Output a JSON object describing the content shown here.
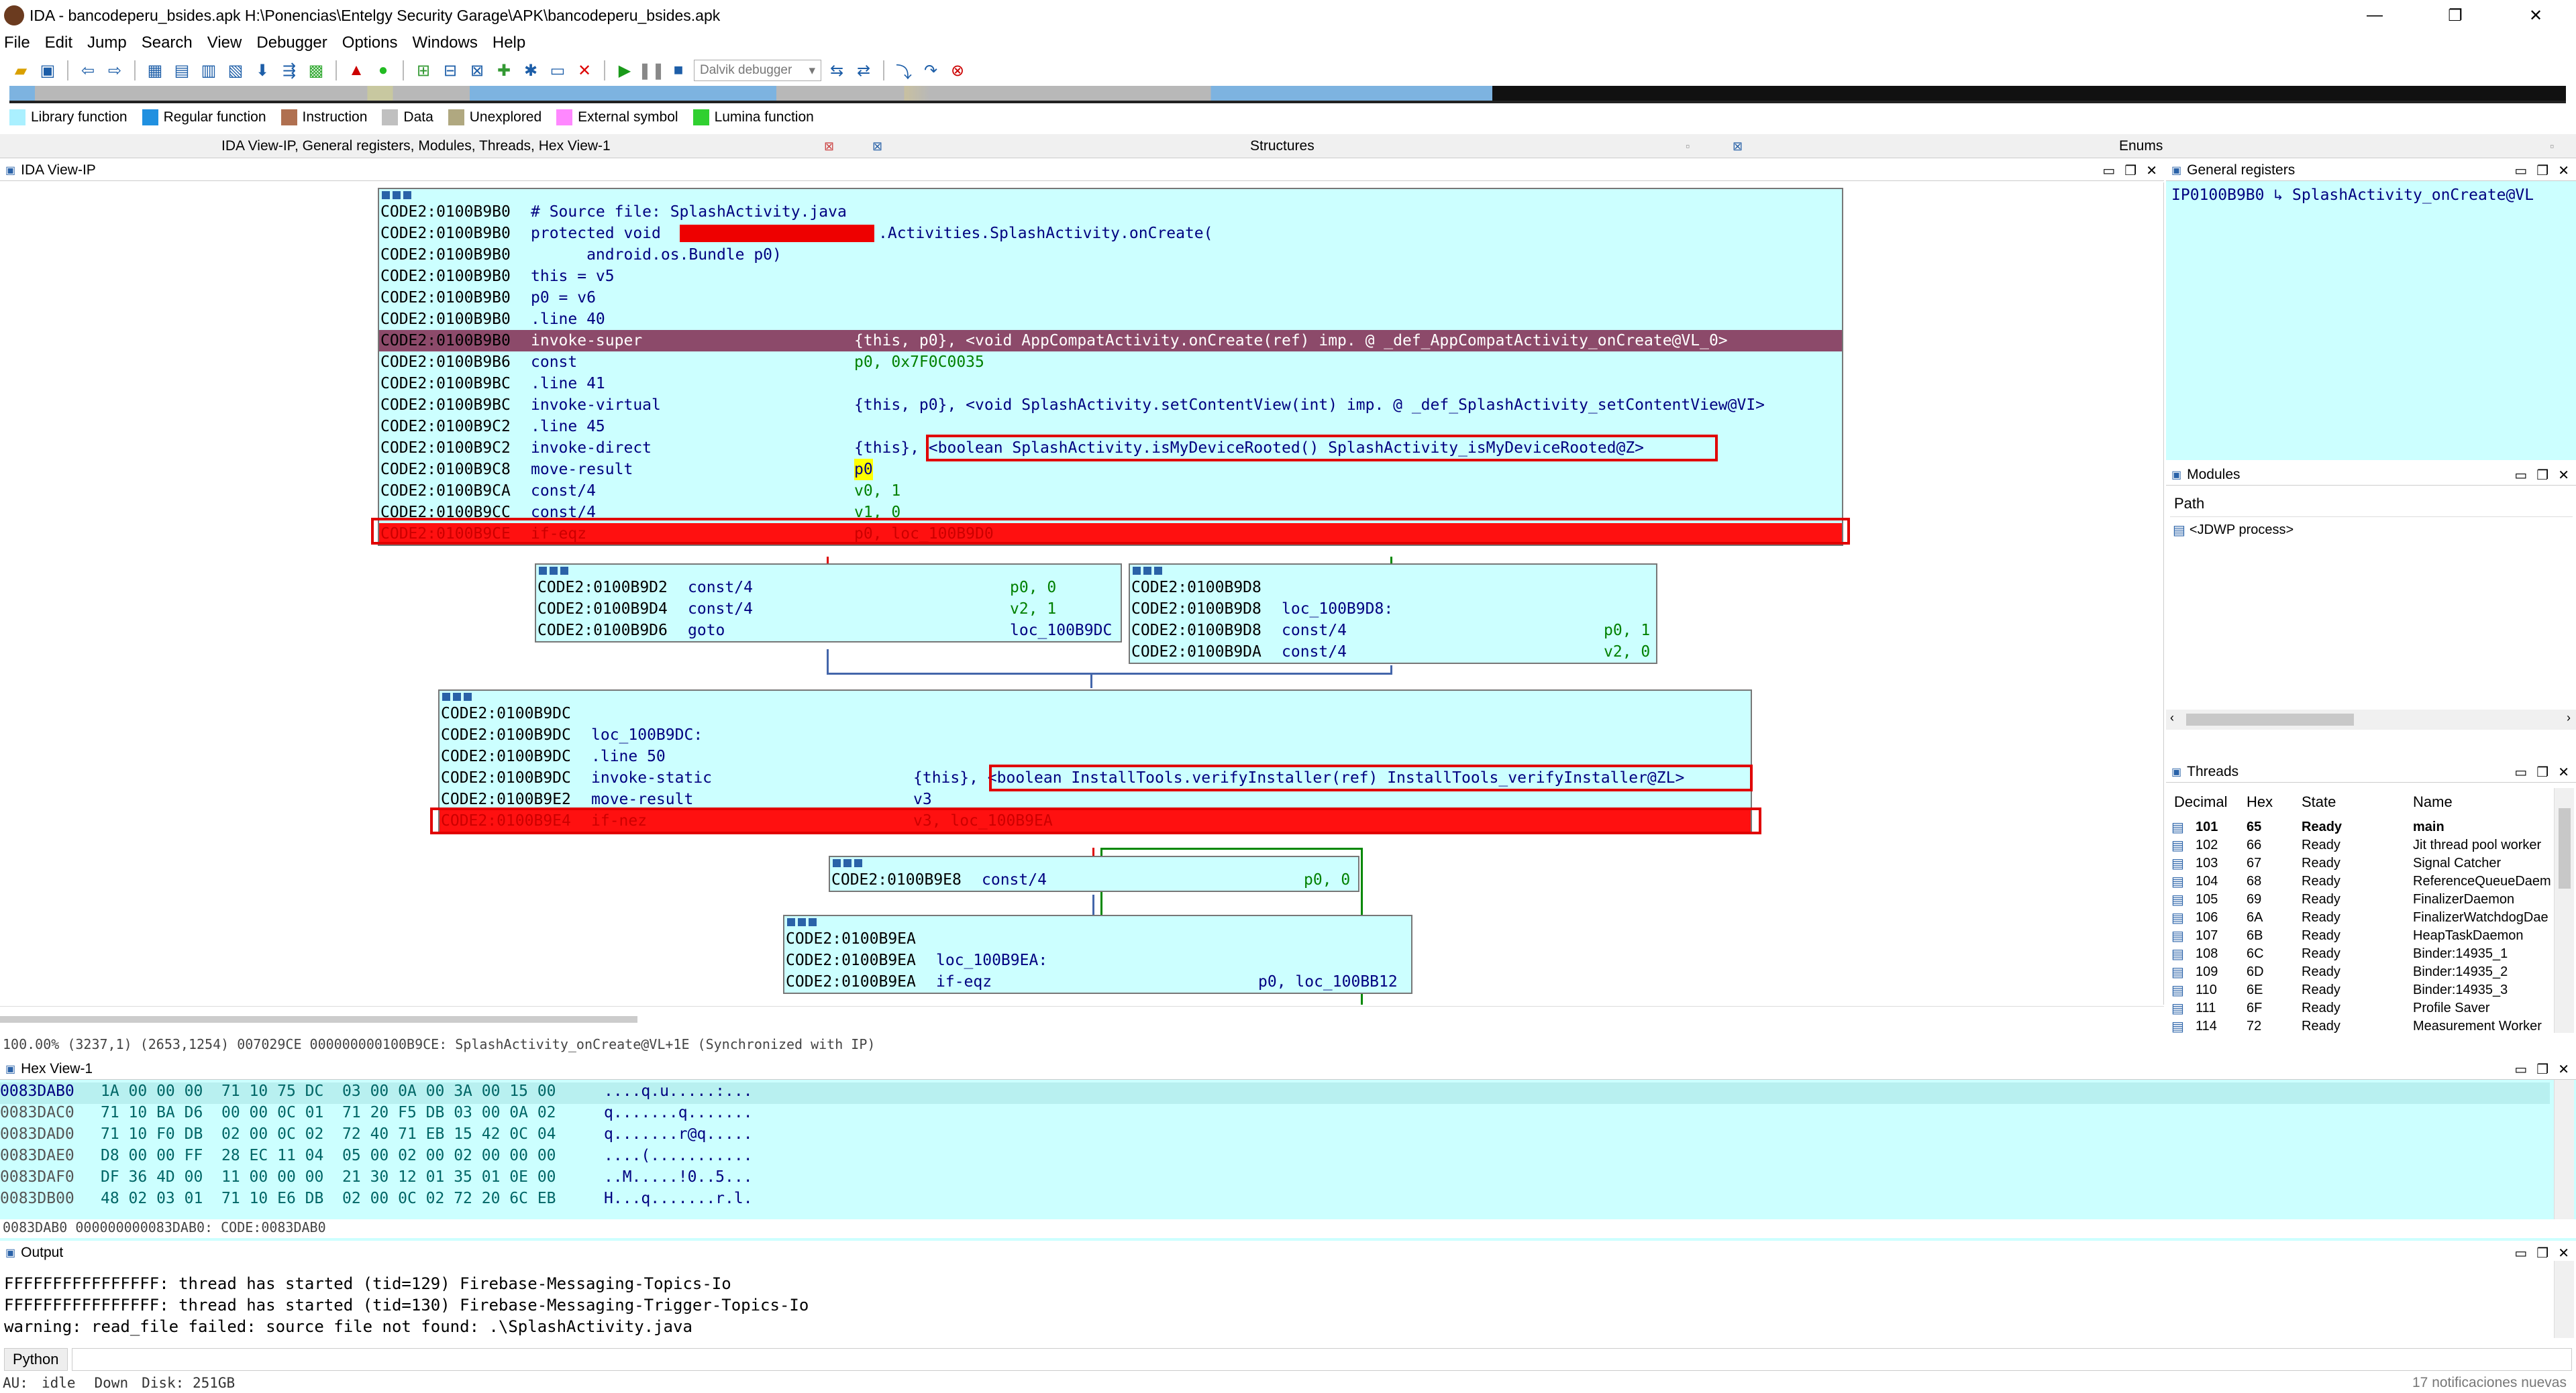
{
  "window": {
    "title": "IDA - bancodeperu_bsides.apk H:\\Ponencias\\Entelgy Security Garage\\APK\\bancodeperu_bsides.apk",
    "controls": [
      "—",
      "❐",
      "✕"
    ]
  },
  "menu": [
    "File",
    "Edit",
    "Jump",
    "Search",
    "View",
    "Debugger",
    "Options",
    "Windows",
    "Help"
  ],
  "toolbar": {
    "debugger_select": "Dalvik debugger"
  },
  "legend": [
    {
      "label": "Library function",
      "color": "#aaf0ff"
    },
    {
      "label": "Regular function",
      "color": "#2090e0"
    },
    {
      "label": "Instruction",
      "color": "#b07050"
    },
    {
      "label": "Data",
      "color": "#c0c0c0"
    },
    {
      "label": "Unexplored",
      "color": "#b0a880"
    },
    {
      "label": "External symbol",
      "color": "#ff88ff"
    },
    {
      "label": "Lumina function",
      "color": "#30d030"
    }
  ],
  "tabs": {
    "main": "IDA View-IP, General registers, Modules, Threads, Hex View-1",
    "structures": "Structures",
    "enums": "Enums"
  },
  "panes": {
    "ida_view": "IDA View-IP",
    "general_registers": "General registers",
    "modules": "Modules",
    "threads": "Threads",
    "hex_view": "Hex View-1",
    "output": "Output"
  },
  "registers": {
    "ip_label": "IP",
    "ip_value": "0100B9B0",
    "ip_target": "SplashActivity_onCreate@VL"
  },
  "modules": {
    "header": "Path",
    "items": [
      "<JDWP process>"
    ]
  },
  "threads": {
    "columns": [
      "Decimal",
      "Hex",
      "State",
      "Name"
    ],
    "rows": [
      {
        "dec": "101",
        "hex": "65",
        "state": "Ready",
        "name": "main"
      },
      {
        "dec": "102",
        "hex": "66",
        "state": "Ready",
        "name": "Jit thread pool worker"
      },
      {
        "dec": "103",
        "hex": "67",
        "state": "Ready",
        "name": "Signal Catcher"
      },
      {
        "dec": "104",
        "hex": "68",
        "state": "Ready",
        "name": "ReferenceQueueDaem"
      },
      {
        "dec": "105",
        "hex": "69",
        "state": "Ready",
        "name": "FinalizerDaemon"
      },
      {
        "dec": "106",
        "hex": "6A",
        "state": "Ready",
        "name": "FinalizerWatchdogDae"
      },
      {
        "dec": "107",
        "hex": "6B",
        "state": "Ready",
        "name": "HeapTaskDaemon"
      },
      {
        "dec": "108",
        "hex": "6C",
        "state": "Ready",
        "name": "Binder:14935_1"
      },
      {
        "dec": "109",
        "hex": "6D",
        "state": "Ready",
        "name": "Binder:14935_2"
      },
      {
        "dec": "110",
        "hex": "6E",
        "state": "Ready",
        "name": "Binder:14935_3"
      },
      {
        "dec": "111",
        "hex": "6F",
        "state": "Ready",
        "name": "Profile Saver"
      },
      {
        "dec": "114",
        "hex": "72",
        "state": "Ready",
        "name": "Measurement Worker"
      }
    ]
  },
  "graph": {
    "node1": [
      {
        "a": "CODE2:0100B9B0",
        "m": "# Source file: SplashActivity.java",
        "o": ""
      },
      {
        "a": "CODE2:0100B9B0",
        "m": "protected void",
        "o": ".Activities.SplashActivity.onCreate("
      },
      {
        "a": "CODE2:0100B9B0",
        "m": "      android.os.Bundle p0)",
        "o": ""
      },
      {
        "a": "CODE2:0100B9B0",
        "m": "this = v5",
        "o": ""
      },
      {
        "a": "CODE2:0100B9B0",
        "m": "p0 = v6",
        "o": ""
      },
      {
        "a": "CODE2:0100B9B0",
        "m": ".line 40",
        "o": ""
      },
      {
        "a": "CODE2:0100B9B0",
        "m": "invoke-super",
        "o": "{this, p0}, <void AppCompatActivity.onCreate(ref) imp. @ _def_AppCompatActivity_onCreate@VL_0>"
      },
      {
        "a": "CODE2:0100B9B6",
        "m": "const",
        "o": "p0, 0x7F0C0035"
      },
      {
        "a": "CODE2:0100B9BC",
        "m": ".line 41",
        "o": ""
      },
      {
        "a": "CODE2:0100B9BC",
        "m": "invoke-virtual",
        "o": "{this, p0}, <void SplashActivity.setContentView(int) imp. @ _def_SplashActivity_setContentView@VI>"
      },
      {
        "a": "CODE2:0100B9C2",
        "m": ".line 45",
        "o": ""
      },
      {
        "a": "CODE2:0100B9C2",
        "m": "invoke-direct",
        "o": "{this}, <boolean SplashActivity.isMyDeviceRooted() SplashActivity_isMyDeviceRooted@Z>"
      },
      {
        "a": "CODE2:0100B9C8",
        "m": "move-result",
        "o": "p0"
      },
      {
        "a": "CODE2:0100B9CA",
        "m": "const/4",
        "o": "v0, 1"
      },
      {
        "a": "CODE2:0100B9CC",
        "m": "const/4",
        "o": "v1, 0"
      },
      {
        "a": "CODE2:0100B9CE",
        "m": "if-eqz",
        "o": "p0, loc_100B9D0"
      }
    ],
    "node2": [
      {
        "a": "CODE2:0100B9D2",
        "m": "const/4",
        "o": "p0, 0"
      },
      {
        "a": "CODE2:0100B9D4",
        "m": "const/4",
        "o": "v2, 1"
      },
      {
        "a": "CODE2:0100B9D6",
        "m": "goto",
        "o": "loc_100B9DC"
      }
    ],
    "node3": [
      {
        "a": "CODE2:0100B9D8",
        "m": "",
        "o": ""
      },
      {
        "a": "CODE2:0100B9D8",
        "m": "loc_100B9D8:",
        "o": ""
      },
      {
        "a": "CODE2:0100B9D8",
        "m": "const/4",
        "o": "p0, 1"
      },
      {
        "a": "CODE2:0100B9DA",
        "m": "const/4",
        "o": "v2, 0"
      }
    ],
    "node4": [
      {
        "a": "CODE2:0100B9DC",
        "m": "",
        "o": ""
      },
      {
        "a": "CODE2:0100B9DC",
        "m": "loc_100B9DC:",
        "o": ""
      },
      {
        "a": "CODE2:0100B9DC",
        "m": ".line 50",
        "o": ""
      },
      {
        "a": "CODE2:0100B9DC",
        "m": "invoke-static",
        "o": "{this}, <boolean InstallTools.verifyInstaller(ref) InstallTools_verifyInstaller@ZL>"
      },
      {
        "a": "CODE2:0100B9E2",
        "m": "move-result",
        "o": "v3"
      },
      {
        "a": "CODE2:0100B9E4",
        "m": "if-nez",
        "o": "v3, loc_100B9EA"
      }
    ],
    "node5": [
      {
        "a": "CODE2:0100B9E8",
        "m": "const/4",
        "o": "p0, 0"
      }
    ],
    "node6": [
      {
        "a": "CODE2:0100B9EA",
        "m": "",
        "o": ""
      },
      {
        "a": "CODE2:0100B9EA",
        "m": "loc_100B9EA:",
        "o": ""
      },
      {
        "a": "CODE2:0100B9EA",
        "m": "if-eqz",
        "o": "p0, loc_100BB12"
      }
    ]
  },
  "ida_status": "100.00% (3237,1) (2653,1254) 007029CE 000000000100B9CE: SplashActivity_onCreate@VL+1E (Synchronized with IP)",
  "hex": {
    "rows": [
      {
        "addr": "0083DAB0",
        "bytes": "1A 00 00 00  71 10 75 DC  03 00 0A 00 3A 00 15 00",
        "ascii": "....q.u.....:..."
      },
      {
        "addr": "0083DAC0",
        "bytes": "71 10 BA D6  00 00 0C 01  71 20 F5 DB 03 00 0A 02",
        "ascii": "q.......q......."
      },
      {
        "addr": "0083DAD0",
        "bytes": "71 10 F0 DB  02 00 0C 02  72 40 71 EB 15 42 0C 04",
        "ascii": "q.......r@q....."
      },
      {
        "addr": "0083DAE0",
        "bytes": "D8 00 00 FF  28 EC 11 04  05 00 02 00 02 00 00 00",
        "ascii": "....(..........."
      },
      {
        "addr": "0083DAF0",
        "bytes": "DF 36 4D 00  11 00 00 00  21 30 12 01 35 01 0E 00",
        "ascii": "..M.....!0..5..."
      },
      {
        "addr": "0083DB00",
        "bytes": "48 02 03 01  71 10 E6 DB  02 00 0C 02 72 20 6C EB",
        "ascii": "H...q.......r.l."
      }
    ],
    "status": "0083DAB0 000000000083DAB0: CODE:0083DAB0"
  },
  "output": {
    "lines": [
      "FFFFFFFFFFFFFFFF: thread has started (tid=129) Firebase-Messaging-Topics-Io",
      "FFFFFFFFFFFFFFFF: thread has started (tid=130) Firebase-Messaging-Trigger-Topics-Io",
      "warning: read_file failed: source file not found: .\\SplashActivity.java"
    ]
  },
  "python_button": "Python",
  "statusbar": {
    "au": "AU:",
    "state": "idle",
    "dir": "Down",
    "disk": "Disk: 251GB",
    "notifications": "17 notificaciones nuevas"
  }
}
